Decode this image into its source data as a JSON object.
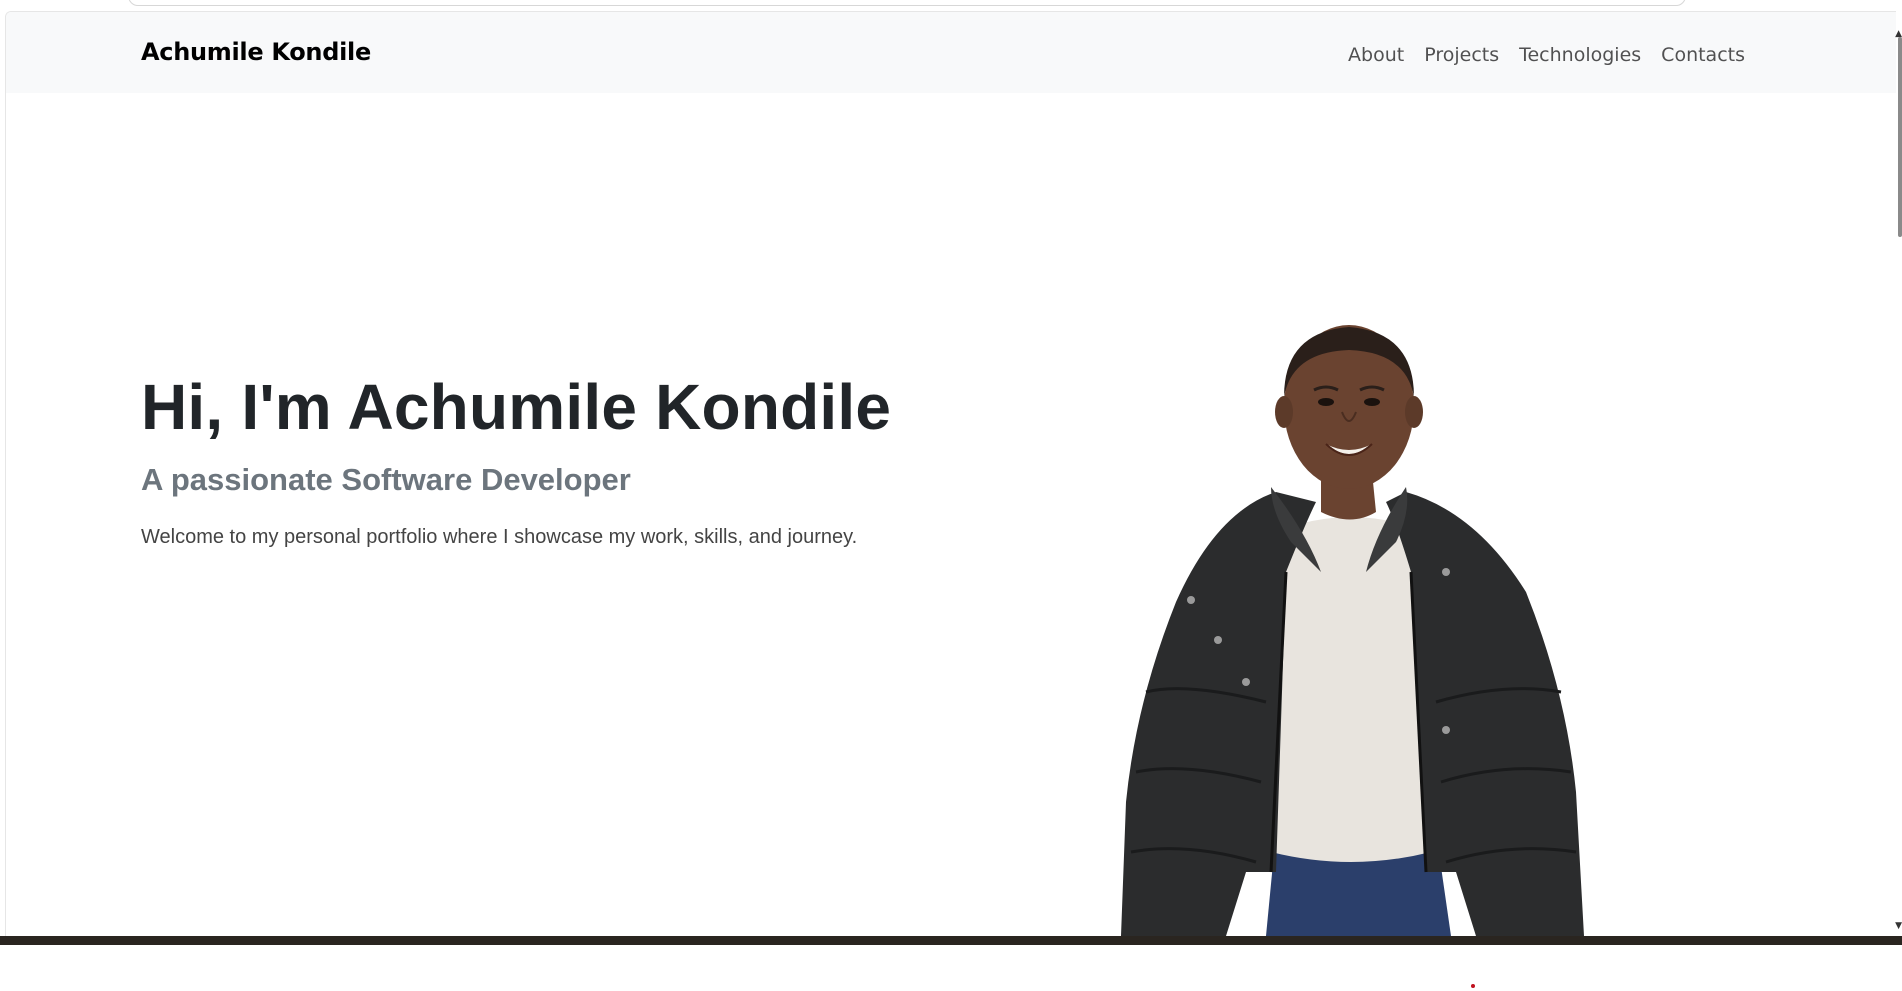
{
  "navbar": {
    "brand": "Achumile Kondile",
    "links": [
      {
        "label": "About"
      },
      {
        "label": "Projects"
      },
      {
        "label": "Technologies"
      },
      {
        "label": "Contacts"
      }
    ]
  },
  "hero": {
    "title": "Hi, I'm Achumile Kondile",
    "subtitle": "A passionate Software Developer",
    "text": "Welcome to my personal portfolio where I showcase my work, skills, and journey."
  },
  "colors": {
    "navbar_bg": "#f8f9fa",
    "title": "#212529",
    "subtitle": "#6c757d",
    "jacket": "#2b2c2d",
    "shirt": "#e8e4de",
    "jeans": "#2b3f6b",
    "skin": "#6a4330"
  },
  "icons": {
    "scroll_up": "chevron-up-icon",
    "scroll_down": "chevron-down-icon"
  }
}
